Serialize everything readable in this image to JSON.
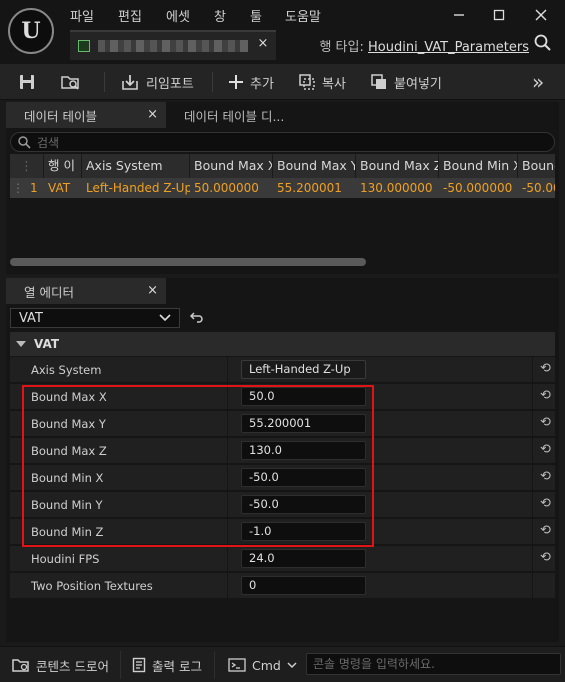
{
  "menu": [
    "파일",
    "편집",
    "에셋",
    "창",
    "툴",
    "도움말"
  ],
  "doc_tab": {
    "close": "×"
  },
  "row_type": {
    "label": "행 타입:",
    "value": "Houdini_VAT_Parameters"
  },
  "toolbar": {
    "reimport": "리임포트",
    "add": "추가",
    "copy": "복사",
    "paste": "붙여넣기",
    "more": "»"
  },
  "data_table": {
    "tab_label": "데이터 테이블",
    "tab2_label": "데이터 테이블 디...",
    "search_placeholder": "검색",
    "columns": [
      "행 이",
      "Axis System",
      "Bound Max X",
      "Bound Max Y",
      "Bound Max Z",
      "Bound Min X",
      "Bound"
    ],
    "row": [
      "1",
      "VAT",
      "Left-Handed Z-Up",
      "50.000000",
      "55.200001",
      "130.000000",
      "-50.000000",
      "-50.00"
    ],
    "row_color": "#f0a020"
  },
  "column_editor": {
    "tab_label": "열 에디터",
    "selected_row": "VAT",
    "category": "VAT",
    "properties": [
      {
        "label": "Axis System",
        "value": "Left-Handed Z-Up"
      },
      {
        "label": "Bound Max X",
        "value": "50.0"
      },
      {
        "label": "Bound Max Y",
        "value": "55.200001"
      },
      {
        "label": "Bound Max Z",
        "value": "130.0"
      },
      {
        "label": "Bound Min X",
        "value": "-50.0"
      },
      {
        "label": "Bound Min Y",
        "value": "-50.0"
      },
      {
        "label": "Bound Min Z",
        "value": "-1.0"
      },
      {
        "label": "Houdini FPS",
        "value": "24.0"
      },
      {
        "label": "Two Position Textures",
        "value": "0"
      }
    ],
    "highlight_color": "#e01414"
  },
  "statusbar": {
    "content_drawer": "콘텐츠 드로어",
    "output_log": "출력 로그",
    "cmd": "Cmd",
    "console_placeholder": "콘솔 명령을 입력하세요."
  }
}
